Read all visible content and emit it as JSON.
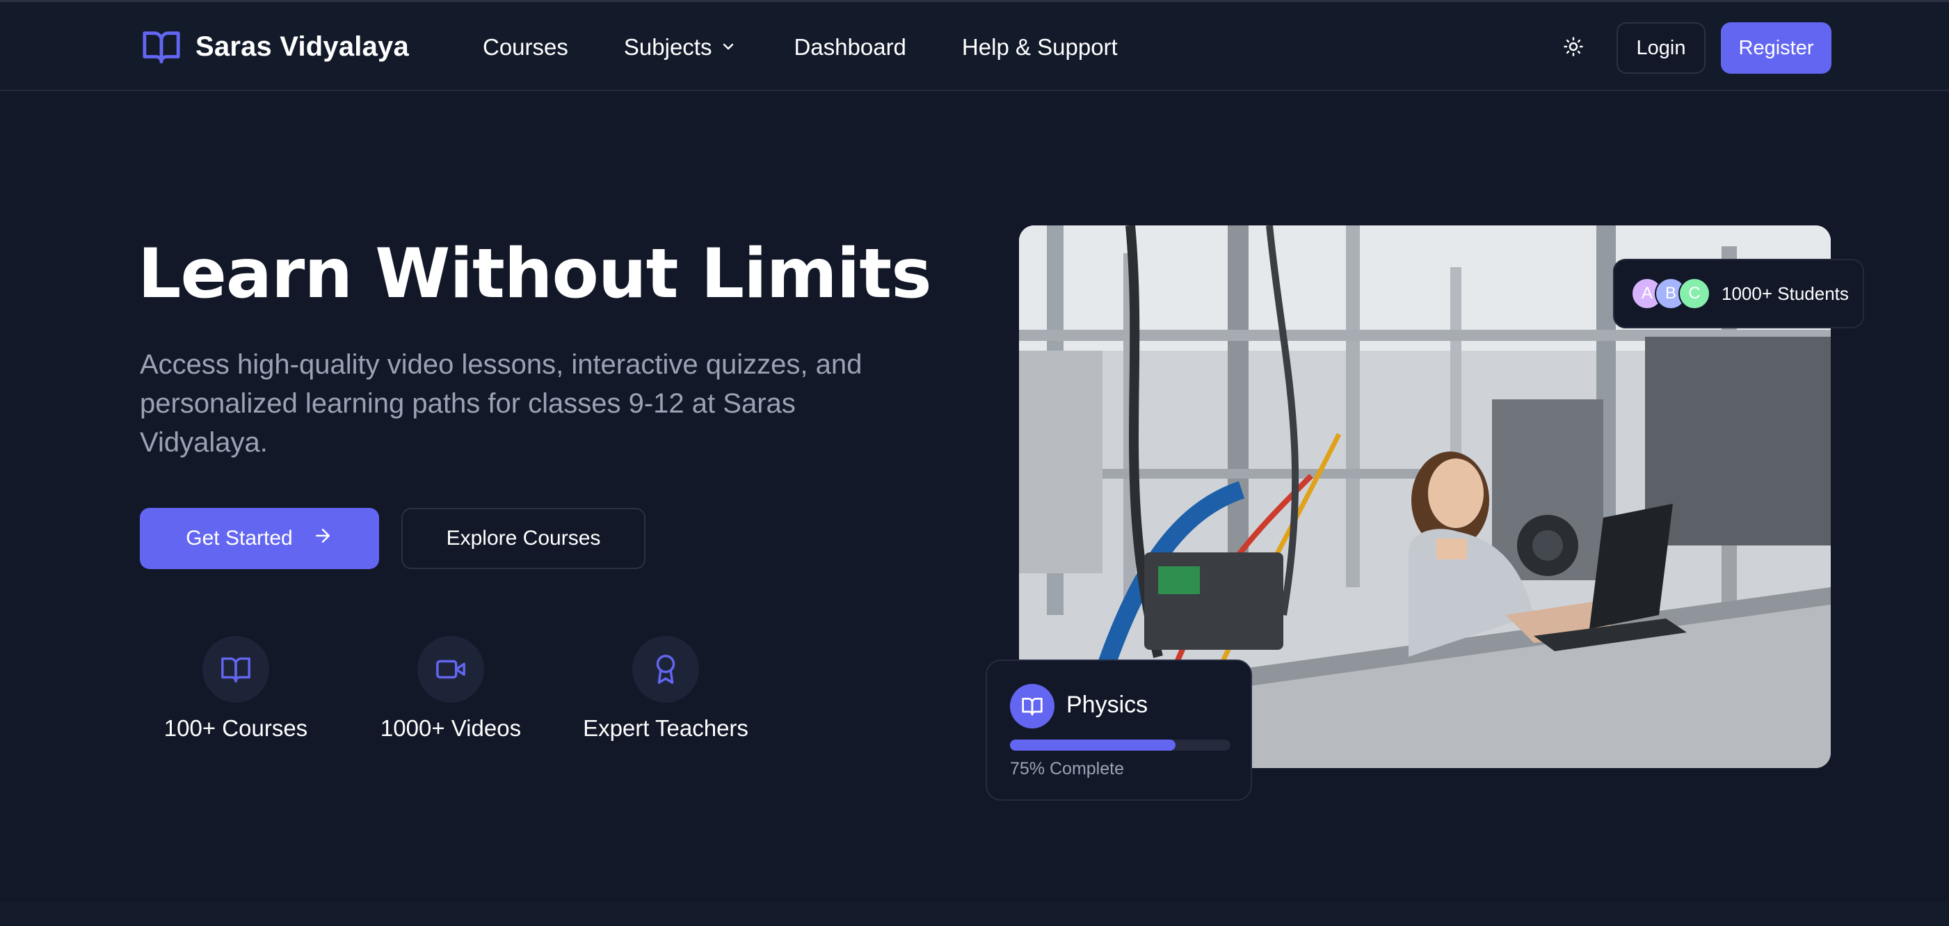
{
  "brand": {
    "name": "Saras Vidyalaya",
    "icon": "book-open-icon",
    "accent": "#6366f1"
  },
  "nav": {
    "courses": "Courses",
    "subjects": "Subjects",
    "dashboard": "Dashboard",
    "help": "Help & Support"
  },
  "header_actions": {
    "theme_icon": "sun-icon",
    "login": "Login",
    "register": "Register"
  },
  "hero": {
    "title": "Learn Without Limits",
    "subtitle": "Access high-quality video lessons, interactive quizzes, and personalized learning paths for classes 9-12 at Saras Vidyalaya.",
    "get_started": "Get Started",
    "explore": "Explore Courses"
  },
  "stats": [
    {
      "label": "100+ Courses",
      "icon": "book-open-icon"
    },
    {
      "label": "1000+ Videos",
      "icon": "video-camera-icon"
    },
    {
      "label": "Expert Teachers",
      "icon": "award-icon"
    }
  ],
  "students_badge": {
    "avatars": [
      {
        "letter": "A",
        "color": "#d8b4fe"
      },
      {
        "letter": "B",
        "color": "#a5b4fc"
      },
      {
        "letter": "C",
        "color": "#86efac"
      }
    ],
    "text": "1000+ Students"
  },
  "progress_card": {
    "subject": "Physics",
    "progress": 0.75,
    "text": "75% Complete"
  },
  "colors": {
    "background": "#121828",
    "accent": "#6366f1",
    "muted_text": "#9aa3b5"
  }
}
